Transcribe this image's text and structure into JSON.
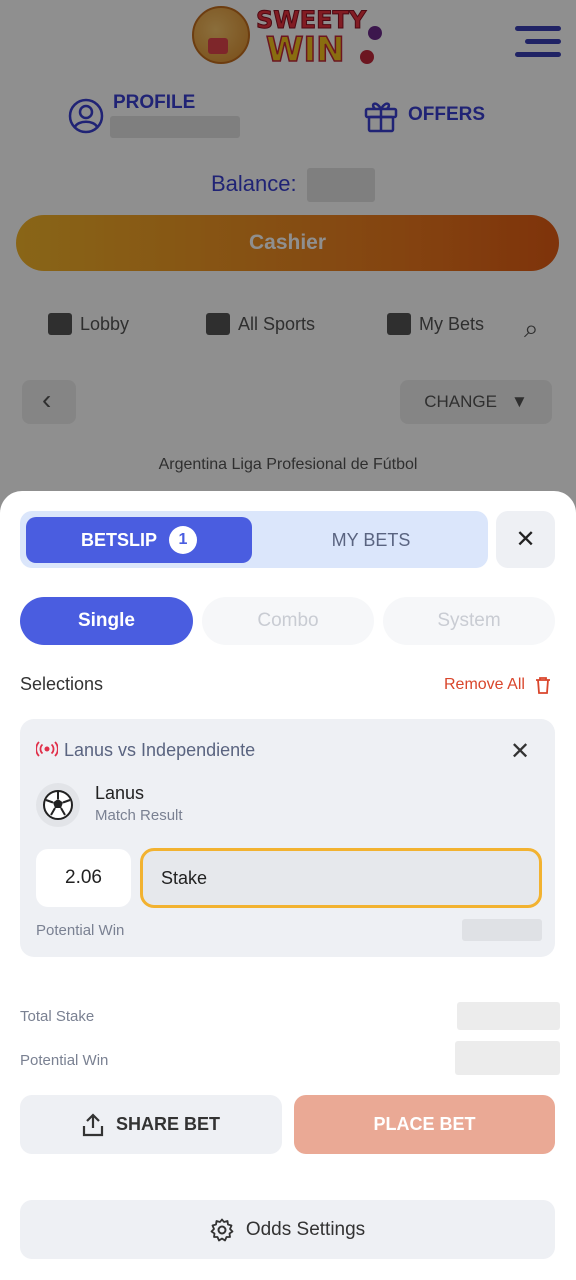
{
  "header": {
    "logo_line1": "SWEETY",
    "logo_line2": "WIN",
    "profile_label": "PROFILE",
    "offers_label": "OFFERS",
    "balance_label": "Balance:",
    "cashier_label": "Cashier"
  },
  "background_page": {
    "nav": [
      "Lobby",
      "All Sports",
      "My Bets"
    ],
    "change_label": "CHANGE",
    "league": "Argentina Liga Profesional de Fútbol"
  },
  "betslip": {
    "tabs": [
      {
        "label": "BETSLIP",
        "count": "1",
        "active": true
      },
      {
        "label": "MY BETS",
        "active": false
      }
    ],
    "bet_types": [
      "Single",
      "Combo",
      "System"
    ],
    "active_bet_type": "Single",
    "selections_title": "Selections",
    "remove_all_label": "Remove All",
    "selection": {
      "match": "Lanus vs Independiente",
      "pick": "Lanus",
      "market": "Match Result",
      "odds": "2.06",
      "stake_placeholder": "Stake",
      "potential_win_label": "Potential Win"
    },
    "total_stake_label": "Total Stake",
    "potential_win_label": "Potential Win",
    "share_label": "SHARE BET",
    "place_label": "PLACE BET",
    "odds_settings_label": "Odds Settings"
  },
  "colors": {
    "primary": "#4a5de0",
    "accent_orange": "#ec7a1e",
    "place_bet_disabled": "#eaa995",
    "stake_focus": "#f2b230",
    "remove_red": "#d9462c"
  }
}
